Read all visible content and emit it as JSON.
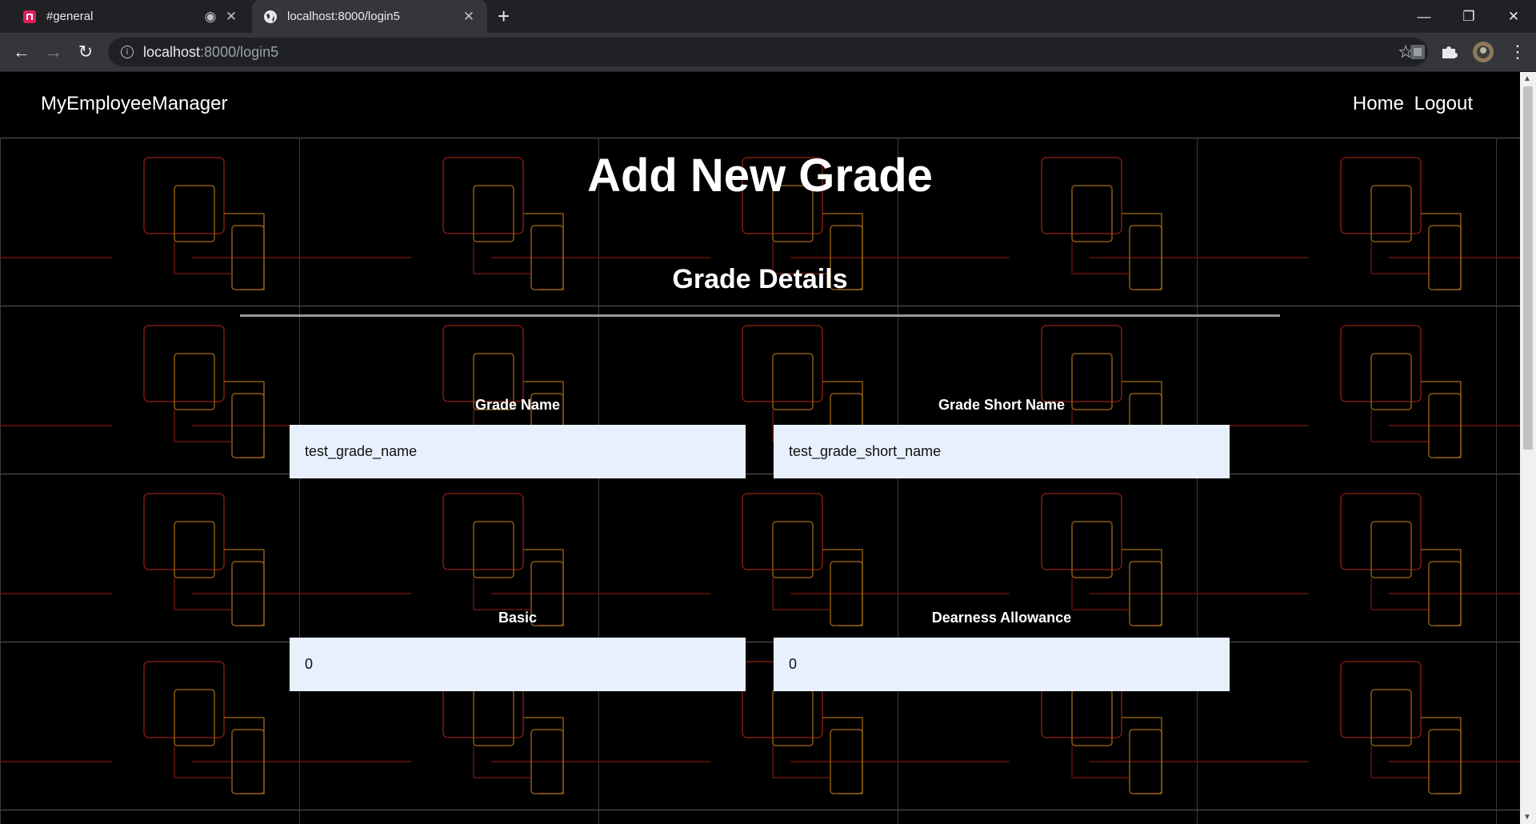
{
  "browser": {
    "tabs": [
      {
        "title": "#general",
        "icon": "slack-icon",
        "active": false
      },
      {
        "title": "localhost:8000/login5",
        "icon": "globe-icon",
        "active": true
      }
    ],
    "url_host": "localhost",
    "url_path": ":8000/login5"
  },
  "navbar": {
    "brand": "MyEmployeeManager",
    "links": [
      "Home",
      "Logout"
    ]
  },
  "page": {
    "title": "Add New Grade",
    "section_title": "Grade Details"
  },
  "form": {
    "grade_name": {
      "label": "Grade Name",
      "value": "test_grade_name"
    },
    "grade_short_name": {
      "label": "Grade Short Name",
      "value": "test_grade_short_name"
    },
    "basic": {
      "label": "Basic",
      "value": "0"
    },
    "dearness_allowance": {
      "label": "Dearness Allowance",
      "value": "0"
    }
  },
  "colors": {
    "background": "#000000",
    "input_bg": "#e8f0fe",
    "pattern_red": "#7a1a10",
    "pattern_orange": "#8a5a10"
  }
}
